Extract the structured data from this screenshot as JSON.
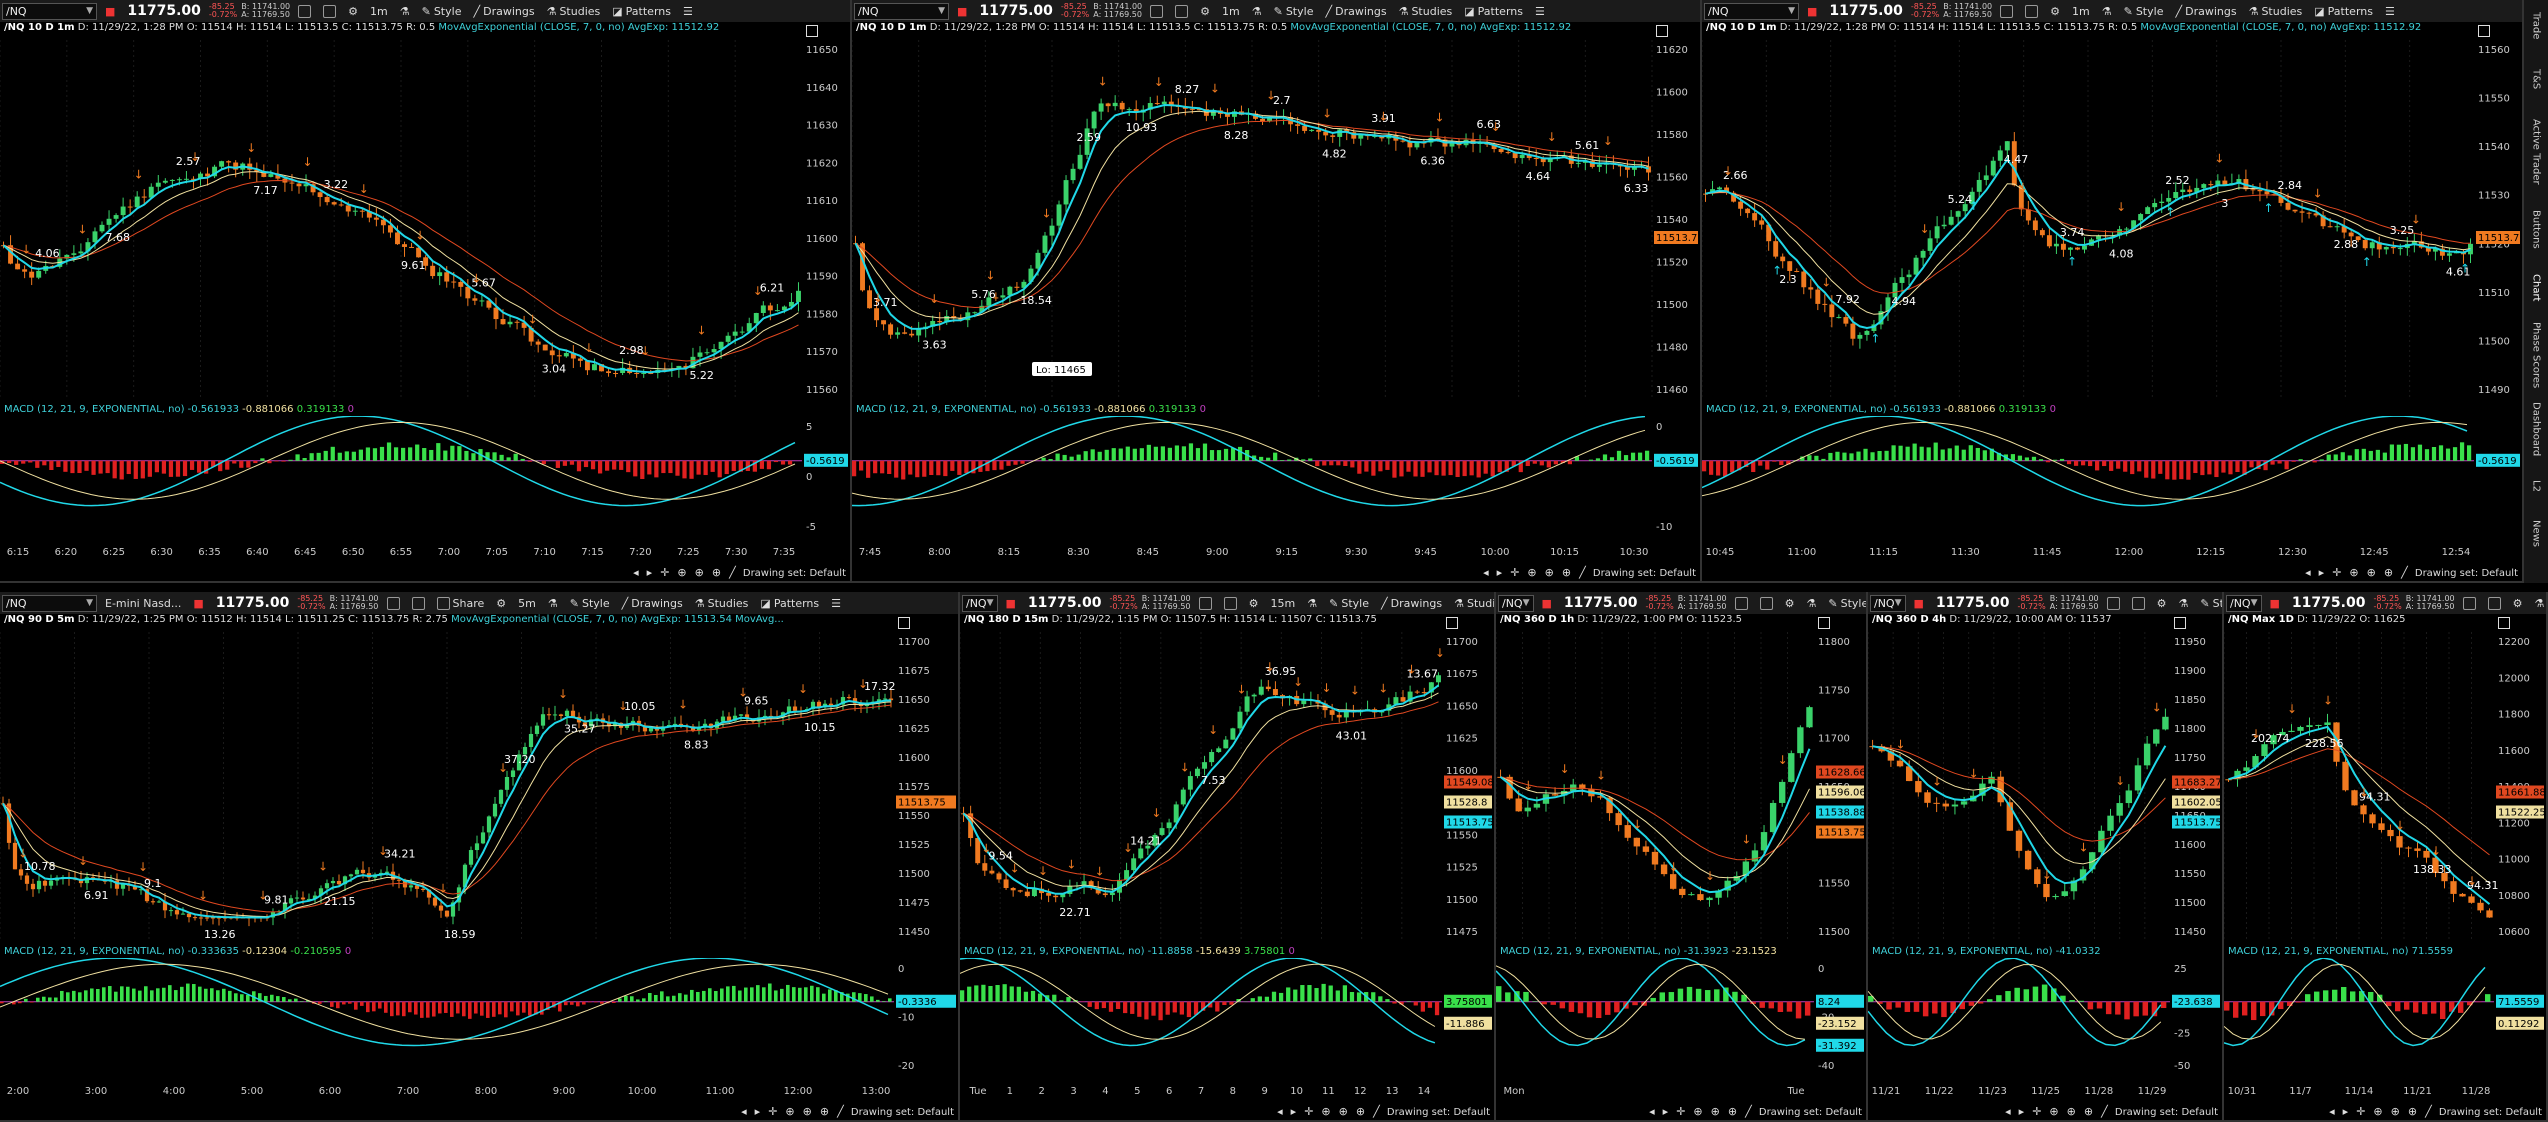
{
  "common": {
    "symbol": "/NQ",
    "last_price": "11775.00",
    "change": "-85.25",
    "change_pct": "-0.72%",
    "bid": "B: 11741.00",
    "ask": "A: 11769.50",
    "style_label": "Style",
    "drawings_label": "Drawings",
    "studies_label": "Studies",
    "patterns_label": "Patterns",
    "share_label": "Share",
    "drawing_set": "Drawing set: Default",
    "macd_label": "MACD (12, 21, 9, EXPONENTIAL, no)",
    "ema_label": "MovAvgExponential (CLOSE, 7, 0, no)",
    "icons": [
      "link-icon",
      "calendar-icon",
      "gear-icon",
      "flask-icon",
      "crosshair-icon",
      "zoom-in-icon",
      "zoom-out-icon",
      "pencil-icon",
      "expand-icon"
    ]
  },
  "sidebar": [
    "Trade",
    "T&S",
    "Active Trader",
    "Buttons",
    "Chart",
    "Phase Scores",
    "Dashboard",
    "L2",
    "News"
  ],
  "panels": [
    {
      "id": "p1",
      "aggregation": "1m",
      "info": "/NQ 10 D 1m",
      "info_detail": "D: 11/29/22, 1:28 PM  O: 11514  H: 11514  L: 11513.5  C: 11513.75  R: 0.5",
      "avg": "AvgExp: 11512.92",
      "macd_vals": [
        "-0.561933",
        "-0.881066",
        "0.319133",
        "0"
      ],
      "macd_tag": "-0.5619",
      "price_ticks": [
        "11650",
        "11640",
        "11630",
        "11620",
        "11610",
        "11600",
        "11590",
        "11580",
        "11570",
        "11560"
      ],
      "macd_ticks": [
        "5",
        "0",
        "-5"
      ],
      "time_ticks": [
        "6:15",
        "6:20",
        "6:25",
        "6:30",
        "6:35",
        "6:40",
        "6:45",
        "6:50",
        "6:55",
        "7:00",
        "7:05",
        "7:10",
        "7:15",
        "7:20",
        "7:25",
        "7:30",
        "7:35"
      ],
      "annotations": [
        "4.06",
        "7.68",
        "2.57",
        "7.17",
        "3.22",
        "9.61",
        "5.67",
        "3.04",
        "2.98",
        "5.22",
        "6.21"
      ],
      "price_tag": ""
    },
    {
      "id": "p2",
      "aggregation": "1m",
      "info": "/NQ 10 D 1m",
      "info_detail": "D: 11/29/22, 1:28 PM  O: 11514  H: 11514  L: 11513.5  C: 11513.75  R: 0.5",
      "avg": "AvgExp: 11512.92",
      "macd_vals": [
        "-0.561933",
        "-0.881066",
        "0.319133",
        "0"
      ],
      "macd_tag": "-0.5619",
      "price_ticks": [
        "11620",
        "11600",
        "11580",
        "11560",
        "11540",
        "11520",
        "11500",
        "11480",
        "11460"
      ],
      "macd_ticks": [
        "0",
        "-10"
      ],
      "time_ticks": [
        "7:45",
        "8:00",
        "8:15",
        "8:30",
        "8:45",
        "9:00",
        "9:15",
        "9:30",
        "9:45",
        "10:00",
        "10:15",
        "10:30"
      ],
      "annotations": [
        "3.71",
        "3.63",
        "5.76",
        "18.54",
        "2.59",
        "10.93",
        "8.27",
        "8.28",
        "2.7",
        "4.82",
        "3.91",
        "6.36",
        "6.63",
        "4.64",
        "5.61",
        "6.33"
      ],
      "lo_label": "Lo: 11465",
      "price_tag": "11513.75"
    },
    {
      "id": "p3",
      "aggregation": "1m",
      "info": "/NQ 10 D 1m",
      "info_detail": "D: 11/29/22, 1:28 PM  O: 11514  H: 11514  L: 11513.5  C: 11513.75  R: 0.5",
      "avg": "AvgExp: 11512.92",
      "macd_vals": [
        "-0.561933",
        "-0.881066",
        "0.319133",
        "0"
      ],
      "macd_tag": "-0.5619",
      "price_ticks": [
        "11560",
        "11550",
        "11540",
        "11530",
        "11520",
        "11510",
        "11500",
        "11490"
      ],
      "macd_ticks": [],
      "time_ticks": [
        "10:45",
        "11:00",
        "11:15",
        "11:30",
        "11:45",
        "12:00",
        "12:15",
        "12:30",
        "12:45",
        "12:54"
      ],
      "annotations": [
        "2.66",
        "2.3",
        "7.92",
        "4.94",
        "5.24",
        "4.47",
        "3.74",
        "4.08",
        "2.52",
        "3",
        "2.84",
        "2.88",
        "3.25",
        "4.61"
      ],
      "price_tag": "11513.75"
    },
    {
      "id": "p4",
      "aggregation": "5m",
      "symbol_desc": "E-mini Nasd...",
      "info": "/NQ 90 D 5m",
      "info_detail": "D: 11/29/22, 1:25 PM  O: 11512  H: 11514  L: 11511.25  C: 11513.75  R: 2.75",
      "avg": "AvgExp: 11513.54",
      "avg2": "MovAvg...",
      "macd_vals": [
        "-0.333635",
        "-0.12304",
        "-0.210595",
        "0"
      ],
      "macd_tag": "-0.3336",
      "price_ticks": [
        "11700",
        "11675",
        "11650",
        "11625",
        "11600",
        "11575",
        "11550",
        "11525",
        "11500",
        "11475",
        "11450"
      ],
      "macd_ticks": [
        "0",
        "-10",
        "-20"
      ],
      "time_ticks": [
        "2:00",
        "3:00",
        "4:00",
        "5:00",
        "6:00",
        "7:00",
        "8:00",
        "9:00",
        "10:00",
        "11:00",
        "12:00",
        "13:00"
      ],
      "annotations": [
        "10.78",
        "6.91",
        "9.1",
        "13.26",
        "9.81",
        "21.15",
        "34.21",
        "18.59",
        "37.20",
        "35.27",
        "10.05",
        "8.83",
        "9.65",
        "10.15",
        "17.32"
      ],
      "price_tag": "11513.75"
    },
    {
      "id": "p5",
      "aggregation": "15m",
      "info": "/NQ 180 D 15m",
      "info_detail": "D: 11/29/22, 1:15 PM  O: 11507.5  H: 11514  L: 11507  C: 11513.75",
      "macd_vals": [
        "-11.8858",
        "-15.6439",
        "3.75801",
        "0"
      ],
      "macd_tag": "3.75801",
      "macd_tag2": "-11.886",
      "price_ticks": [
        "11700",
        "11675",
        "11650",
        "11625",
        "11600",
        "11575",
        "11550",
        "11525",
        "11500",
        "11475"
      ],
      "macd_ticks": [],
      "time_ticks": [
        "Tue",
        "1",
        "2",
        "3",
        "4",
        "5",
        "6",
        "7",
        "8",
        "9",
        "10",
        "11",
        "12",
        "13",
        "14"
      ],
      "annotations": [
        "9.54",
        "22.71",
        "14.21",
        "7.53",
        "36.95",
        "43.01",
        "13.67"
      ],
      "price_tags": [
        "11549.08",
        "11528.8",
        "11513.75"
      ]
    },
    {
      "id": "p6",
      "info": "/NQ 360 D 1h",
      "info_detail": "D: 11/29/22, 1:00 PM  O: 11523.5",
      "macd_vals": [
        "-31.3923",
        "-23.1523"
      ],
      "macd_tags": [
        "8.24",
        "-23.152",
        "-31.392"
      ],
      "price_ticks": [
        "11800",
        "11750",
        "11700",
        "11650",
        "11600",
        "11550",
        "11500"
      ],
      "macd_ticks": [
        "0",
        "-20",
        "-40"
      ],
      "time_ticks": [
        "Mon",
        "Tue"
      ],
      "price_tags": [
        "11628.66",
        "11596.06",
        "11538.88",
        "11513.75"
      ]
    },
    {
      "id": "p7",
      "info": "/NQ 360 D 4h",
      "info_detail": "D: 11/29/22, 10:00 AM  O: 11537",
      "macd_vals": [
        "-41.0332"
      ],
      "macd_tags": [
        "-23.638"
      ],
      "price_ticks": [
        "11950",
        "11900",
        "11850",
        "11800",
        "11750",
        "11700",
        "11650",
        "11600",
        "11550",
        "11500",
        "11450"
      ],
      "macd_ticks": [
        "25",
        "0",
        "-25",
        "-50"
      ],
      "time_ticks": [
        "11/21",
        "11/22",
        "11/23",
        "11/25",
        "11/28",
        "11/29"
      ],
      "price_tags": [
        "11683.27",
        "11602.05",
        "11513.75"
      ]
    },
    {
      "id": "p8",
      "info": "/NQ Max 1D",
      "info_detail": "D: 11/29/22  O: 11625",
      "macd_vals": [
        "71.5559"
      ],
      "macd_tags": [
        "71.5559",
        "0.11292"
      ],
      "price_ticks": [
        "12200",
        "12000",
        "11800",
        "11600",
        "11400",
        "11200",
        "11000",
        "10800",
        "10600"
      ],
      "macd_ticks": [],
      "time_ticks": [
        "10/31",
        "11/7",
        "11/14",
        "11/21",
        "11/28"
      ],
      "annotations": [
        "202.74",
        "228.56",
        "94.31",
        "138.33",
        "94.31"
      ],
      "price_tags": [
        "11661.88",
        "11522.25"
      ]
    }
  ]
}
